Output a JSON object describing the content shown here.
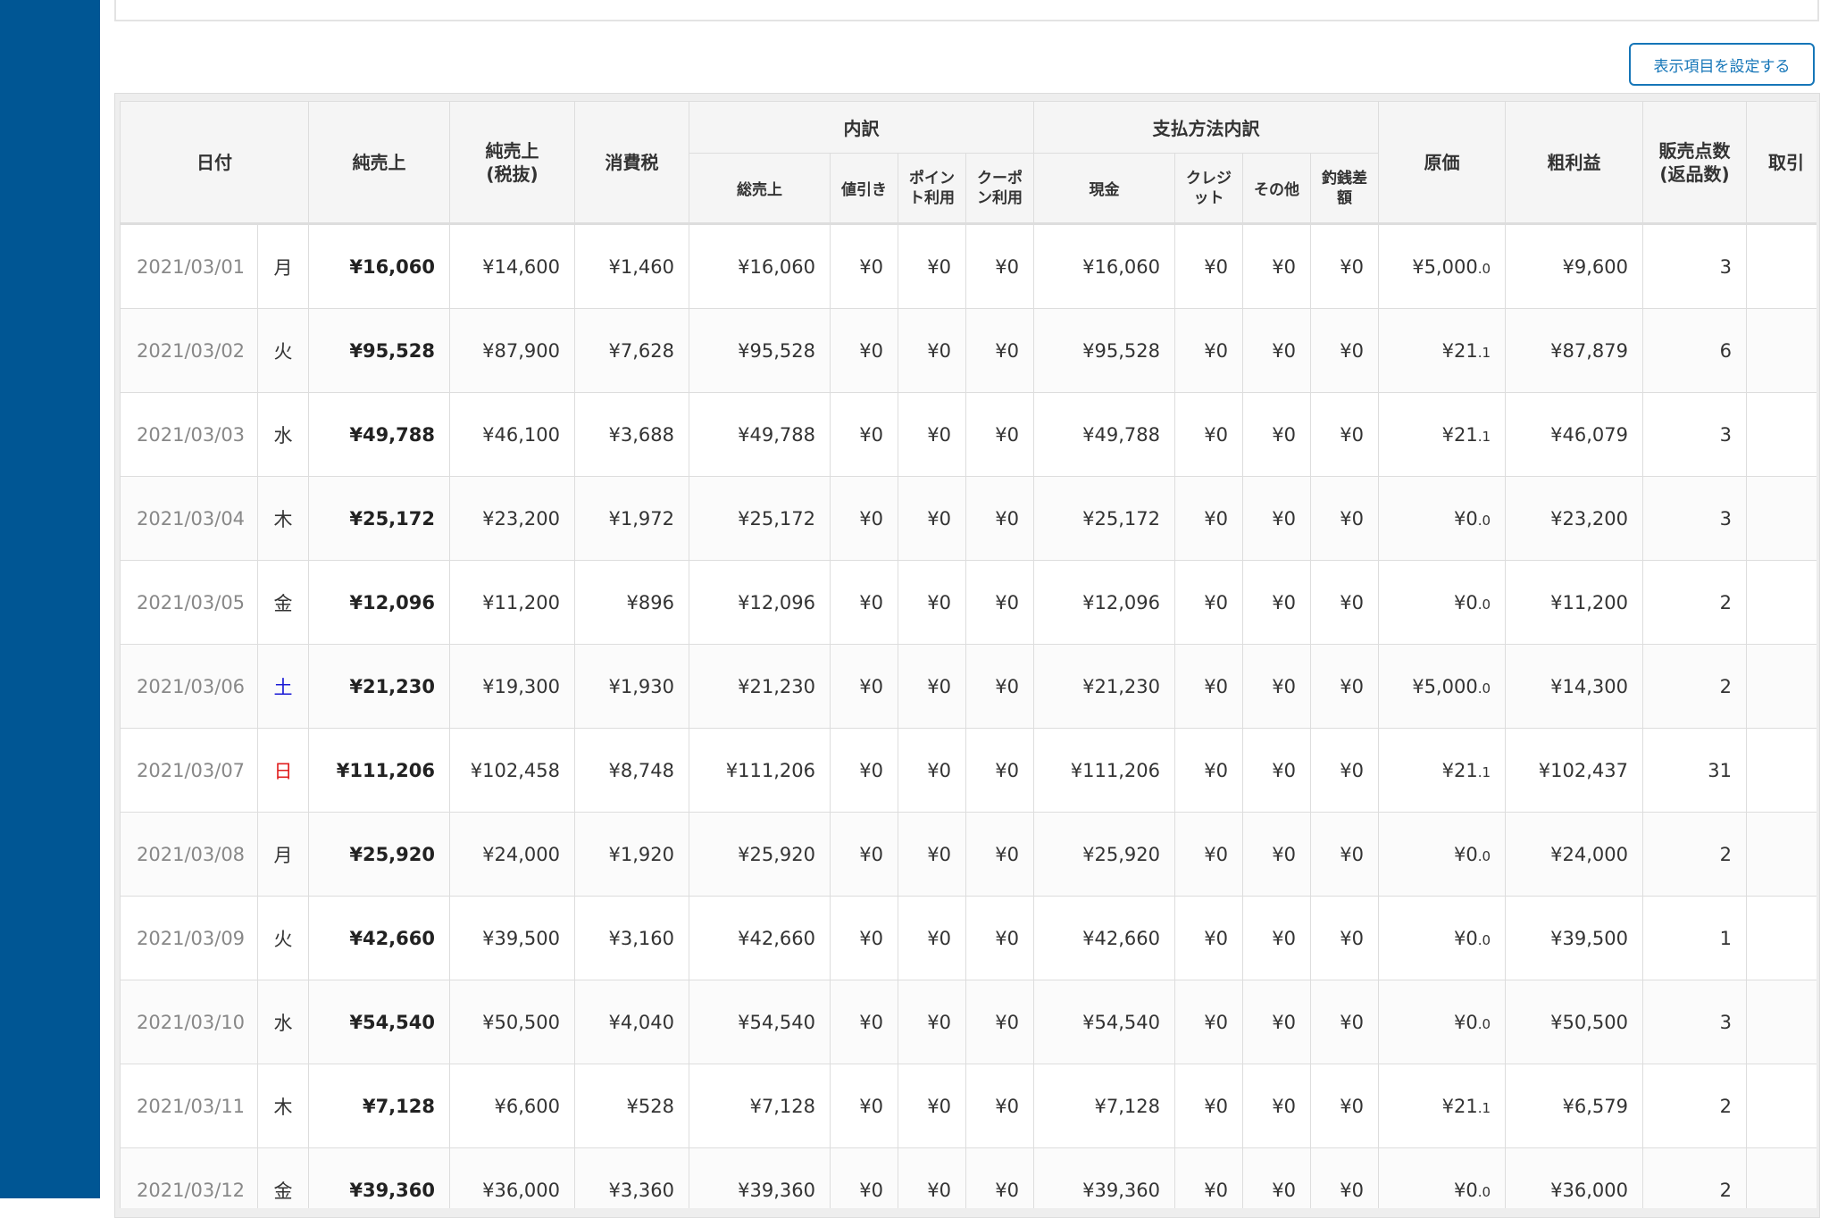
{
  "button": {
    "settings_label": "表示項目を設定する"
  },
  "header": {
    "date": "日付",
    "net_sales": "純売上",
    "net_sales_ex_tax_l1": "純売上",
    "net_sales_ex_tax_l2": "(税抜)",
    "tax": "消費税",
    "breakdown": "内訳",
    "payment_breakdown": "支払方法内訳",
    "cost": "原価",
    "gross_profit": "粗利益",
    "items_sold_l1": "販売点数",
    "items_sold_l2": "(返品数)",
    "transactions": "取引",
    "gross_sales": "総売上",
    "discount": "値引き",
    "points_l1": "ポイン",
    "points_l2": "ト利用",
    "coupon_l1": "クーポ",
    "coupon_l2": "ン利用",
    "cash": "現金",
    "credit_l1": "クレジ",
    "credit_l2": "ット",
    "other": "その他",
    "change_diff_l1": "釣銭差",
    "change_diff_l2": "額"
  },
  "rows": [
    {
      "date": "2021/03/01",
      "dow": "月",
      "net": "¥16,060",
      "net_ex": "¥14,600",
      "tax": "¥1,460",
      "gross": "¥16,060",
      "discount": "¥0",
      "points": "¥0",
      "coupon": "¥0",
      "cash": "¥16,060",
      "credit": "¥0",
      "other": "¥0",
      "change": "¥0",
      "cost_int": "¥5,000",
      "cost_dec": ".0",
      "profit": "¥9,600",
      "items": "3"
    },
    {
      "date": "2021/03/02",
      "dow": "火",
      "net": "¥95,528",
      "net_ex": "¥87,900",
      "tax": "¥7,628",
      "gross": "¥95,528",
      "discount": "¥0",
      "points": "¥0",
      "coupon": "¥0",
      "cash": "¥95,528",
      "credit": "¥0",
      "other": "¥0",
      "change": "¥0",
      "cost_int": "¥21",
      "cost_dec": ".1",
      "profit": "¥87,879",
      "items": "6"
    },
    {
      "date": "2021/03/03",
      "dow": "水",
      "net": "¥49,788",
      "net_ex": "¥46,100",
      "tax": "¥3,688",
      "gross": "¥49,788",
      "discount": "¥0",
      "points": "¥0",
      "coupon": "¥0",
      "cash": "¥49,788",
      "credit": "¥0",
      "other": "¥0",
      "change": "¥0",
      "cost_int": "¥21",
      "cost_dec": ".1",
      "profit": "¥46,079",
      "items": "3"
    },
    {
      "date": "2021/03/04",
      "dow": "木",
      "net": "¥25,172",
      "net_ex": "¥23,200",
      "tax": "¥1,972",
      "gross": "¥25,172",
      "discount": "¥0",
      "points": "¥0",
      "coupon": "¥0",
      "cash": "¥25,172",
      "credit": "¥0",
      "other": "¥0",
      "change": "¥0",
      "cost_int": "¥0",
      "cost_dec": ".0",
      "profit": "¥23,200",
      "items": "3"
    },
    {
      "date": "2021/03/05",
      "dow": "金",
      "net": "¥12,096",
      "net_ex": "¥11,200",
      "tax": "¥896",
      "gross": "¥12,096",
      "discount": "¥0",
      "points": "¥0",
      "coupon": "¥0",
      "cash": "¥12,096",
      "credit": "¥0",
      "other": "¥0",
      "change": "¥0",
      "cost_int": "¥0",
      "cost_dec": ".0",
      "profit": "¥11,200",
      "items": "2"
    },
    {
      "date": "2021/03/06",
      "dow": "土",
      "net": "¥21,230",
      "net_ex": "¥19,300",
      "tax": "¥1,930",
      "gross": "¥21,230",
      "discount": "¥0",
      "points": "¥0",
      "coupon": "¥0",
      "cash": "¥21,230",
      "credit": "¥0",
      "other": "¥0",
      "change": "¥0",
      "cost_int": "¥5,000",
      "cost_dec": ".0",
      "profit": "¥14,300",
      "items": "2"
    },
    {
      "date": "2021/03/07",
      "dow": "日",
      "net": "¥111,206",
      "net_ex": "¥102,458",
      "tax": "¥8,748",
      "gross": "¥111,206",
      "discount": "¥0",
      "points": "¥0",
      "coupon": "¥0",
      "cash": "¥111,206",
      "credit": "¥0",
      "other": "¥0",
      "change": "¥0",
      "cost_int": "¥21",
      "cost_dec": ".1",
      "profit": "¥102,437",
      "items": "31"
    },
    {
      "date": "2021/03/08",
      "dow": "月",
      "net": "¥25,920",
      "net_ex": "¥24,000",
      "tax": "¥1,920",
      "gross": "¥25,920",
      "discount": "¥0",
      "points": "¥0",
      "coupon": "¥0",
      "cash": "¥25,920",
      "credit": "¥0",
      "other": "¥0",
      "change": "¥0",
      "cost_int": "¥0",
      "cost_dec": ".0",
      "profit": "¥24,000",
      "items": "2"
    },
    {
      "date": "2021/03/09",
      "dow": "火",
      "net": "¥42,660",
      "net_ex": "¥39,500",
      "tax": "¥3,160",
      "gross": "¥42,660",
      "discount": "¥0",
      "points": "¥0",
      "coupon": "¥0",
      "cash": "¥42,660",
      "credit": "¥0",
      "other": "¥0",
      "change": "¥0",
      "cost_int": "¥0",
      "cost_dec": ".0",
      "profit": "¥39,500",
      "items": "1"
    },
    {
      "date": "2021/03/10",
      "dow": "水",
      "net": "¥54,540",
      "net_ex": "¥50,500",
      "tax": "¥4,040",
      "gross": "¥54,540",
      "discount": "¥0",
      "points": "¥0",
      "coupon": "¥0",
      "cash": "¥54,540",
      "credit": "¥0",
      "other": "¥0",
      "change": "¥0",
      "cost_int": "¥0",
      "cost_dec": ".0",
      "profit": "¥50,500",
      "items": "3"
    },
    {
      "date": "2021/03/11",
      "dow": "木",
      "net": "¥7,128",
      "net_ex": "¥6,600",
      "tax": "¥528",
      "gross": "¥7,128",
      "discount": "¥0",
      "points": "¥0",
      "coupon": "¥0",
      "cash": "¥7,128",
      "credit": "¥0",
      "other": "¥0",
      "change": "¥0",
      "cost_int": "¥21",
      "cost_dec": ".1",
      "profit": "¥6,579",
      "items": "2"
    },
    {
      "date": "2021/03/12",
      "dow": "金",
      "net": "¥39,360",
      "net_ex": "¥36,000",
      "tax": "¥3,360",
      "gross": "¥39,360",
      "discount": "¥0",
      "points": "¥0",
      "coupon": "¥0",
      "cash": "¥39,360",
      "credit": "¥0",
      "other": "¥0",
      "change": "¥0",
      "cost_int": "¥0",
      "cost_dec": ".0",
      "profit": "¥36,000",
      "items": "2"
    }
  ]
}
